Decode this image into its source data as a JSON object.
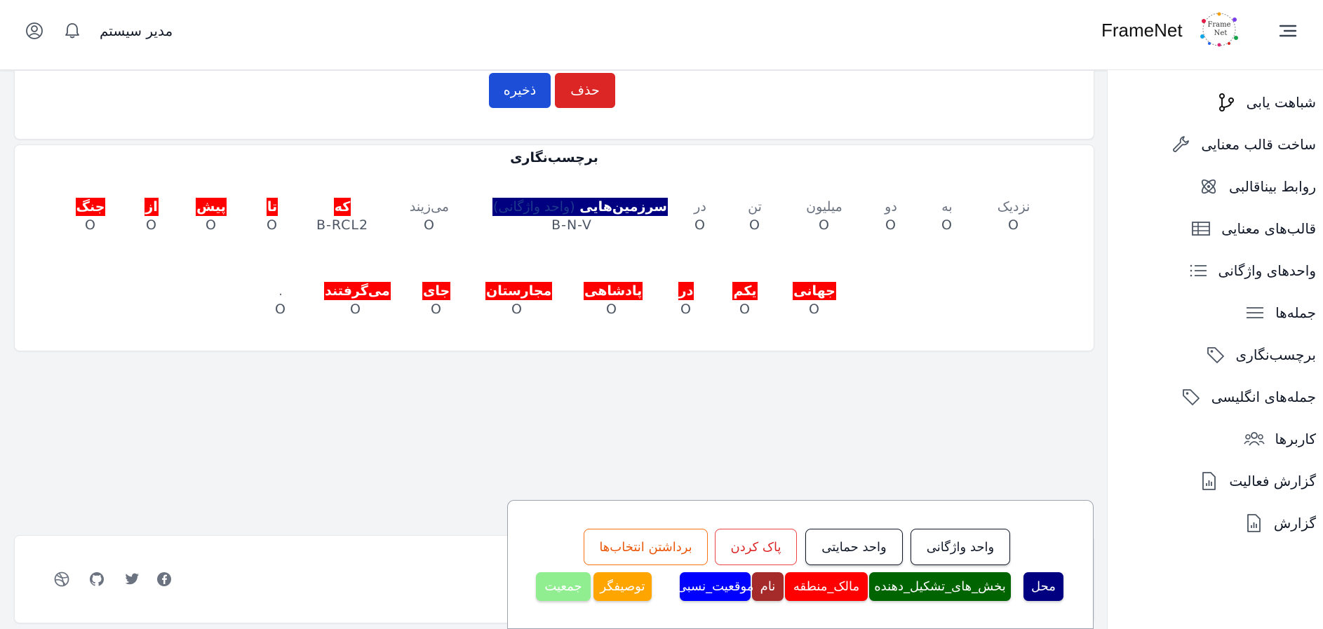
{
  "header": {
    "brand": "FrameNet",
    "user_name": "مدیر سیستم",
    "icons": [
      "menu-icon",
      "framenet-logo",
      "notification-bell-icon",
      "user-circle-icon"
    ]
  },
  "sidebar": {
    "items": [
      {
        "label": "شباهت یابی",
        "icon": "branch-icon"
      },
      {
        "label": "ساخت قالب معنایی",
        "icon": "wrench-icon"
      },
      {
        "label": "روابط بیناقالبی",
        "icon": "atom-icon"
      },
      {
        "label": "قالب‌های معنایی",
        "icon": "table-icon"
      },
      {
        "label": "واحدهای واژگانی",
        "icon": "list-icon"
      },
      {
        "label": "جمله‌ها",
        "icon": "lines-icon"
      },
      {
        "label": "برچسب‌نگاری",
        "icon": "tag-icon"
      },
      {
        "label": "جمله‌های انگلیسی",
        "icon": "tag-icon"
      },
      {
        "label": "کاربرها",
        "icon": "users-icon"
      },
      {
        "label": "گزارش فعالیت",
        "icon": "report-icon"
      },
      {
        "label": "گزارش",
        "icon": "report-icon"
      }
    ]
  },
  "actions": {
    "delete_label": "حذف",
    "save_label": "ذخیره"
  },
  "annotation": {
    "title": "برچسب‌نگاری",
    "line1": [
      {
        "word": "نزدیک",
        "tag": "O",
        "style": "plain"
      },
      {
        "word": "به",
        "tag": "O",
        "style": "plain"
      },
      {
        "word": "دو",
        "tag": "O",
        "style": "plain"
      },
      {
        "word": "میلیون",
        "tag": "O",
        "style": "plain"
      },
      {
        "word": "تن",
        "tag": "O",
        "style": "plain"
      },
      {
        "word": "در",
        "tag": "O",
        "style": "plain"
      },
      {
        "word": "سرزمین‌هایی",
        "sub": "(واحد واژگانی)",
        "tag": "B-N-V",
        "style": "navy"
      },
      {
        "word": "می‌زیند",
        "tag": "O",
        "style": "plain"
      },
      {
        "word": "که",
        "tag": "B-RCL2",
        "style": "red"
      },
      {
        "word": "تا",
        "tag": "O",
        "style": "red"
      },
      {
        "word": "پیش",
        "tag": "O",
        "style": "red"
      },
      {
        "word": "از",
        "tag": "O",
        "style": "red"
      },
      {
        "word": "جنگ",
        "tag": "O",
        "style": "red"
      }
    ],
    "line2": [
      {
        "word": "جهانی",
        "tag": "O",
        "style": "red"
      },
      {
        "word": "یکم",
        "tag": "O",
        "style": "red"
      },
      {
        "word": "در",
        "tag": "O",
        "style": "red"
      },
      {
        "word": "پادشاهی",
        "tag": "O",
        "style": "red"
      },
      {
        "word": "مجارستان",
        "tag": "O",
        "style": "red"
      },
      {
        "word": "جای",
        "tag": "O",
        "style": "red"
      },
      {
        "word": "می‌گرفتند",
        "tag": "O",
        "style": "red"
      },
      {
        "word": ".",
        "tag": "O",
        "style": "plain"
      }
    ]
  },
  "panel": {
    "buttons": {
      "lexical_unit": "واحد واژگانی",
      "support_unit": "واحد حمایتی",
      "clear": "پاک کردن",
      "deselect": "برداشتن انتخاب‌ها"
    },
    "tags": [
      {
        "label": "محل",
        "color": "#000080"
      },
      {
        "label": "بخش_های_تشکیل_دهنده",
        "color": "#006400"
      },
      {
        "label": "مالک_منطقه",
        "color": "#ff0000"
      },
      {
        "label": "نام",
        "color": "#a52a2a"
      },
      {
        "label": "موقعیت_نسبی",
        "color": "#0000ff"
      },
      {
        "label": "توصیفگر",
        "color": "#ffa500"
      },
      {
        "label": "جمعیت",
        "color": "#90ee90"
      }
    ]
  },
  "footer": {
    "social_icons": [
      "facebook-icon",
      "twitter-icon",
      "github-icon",
      "dribbble-icon"
    ]
  }
}
